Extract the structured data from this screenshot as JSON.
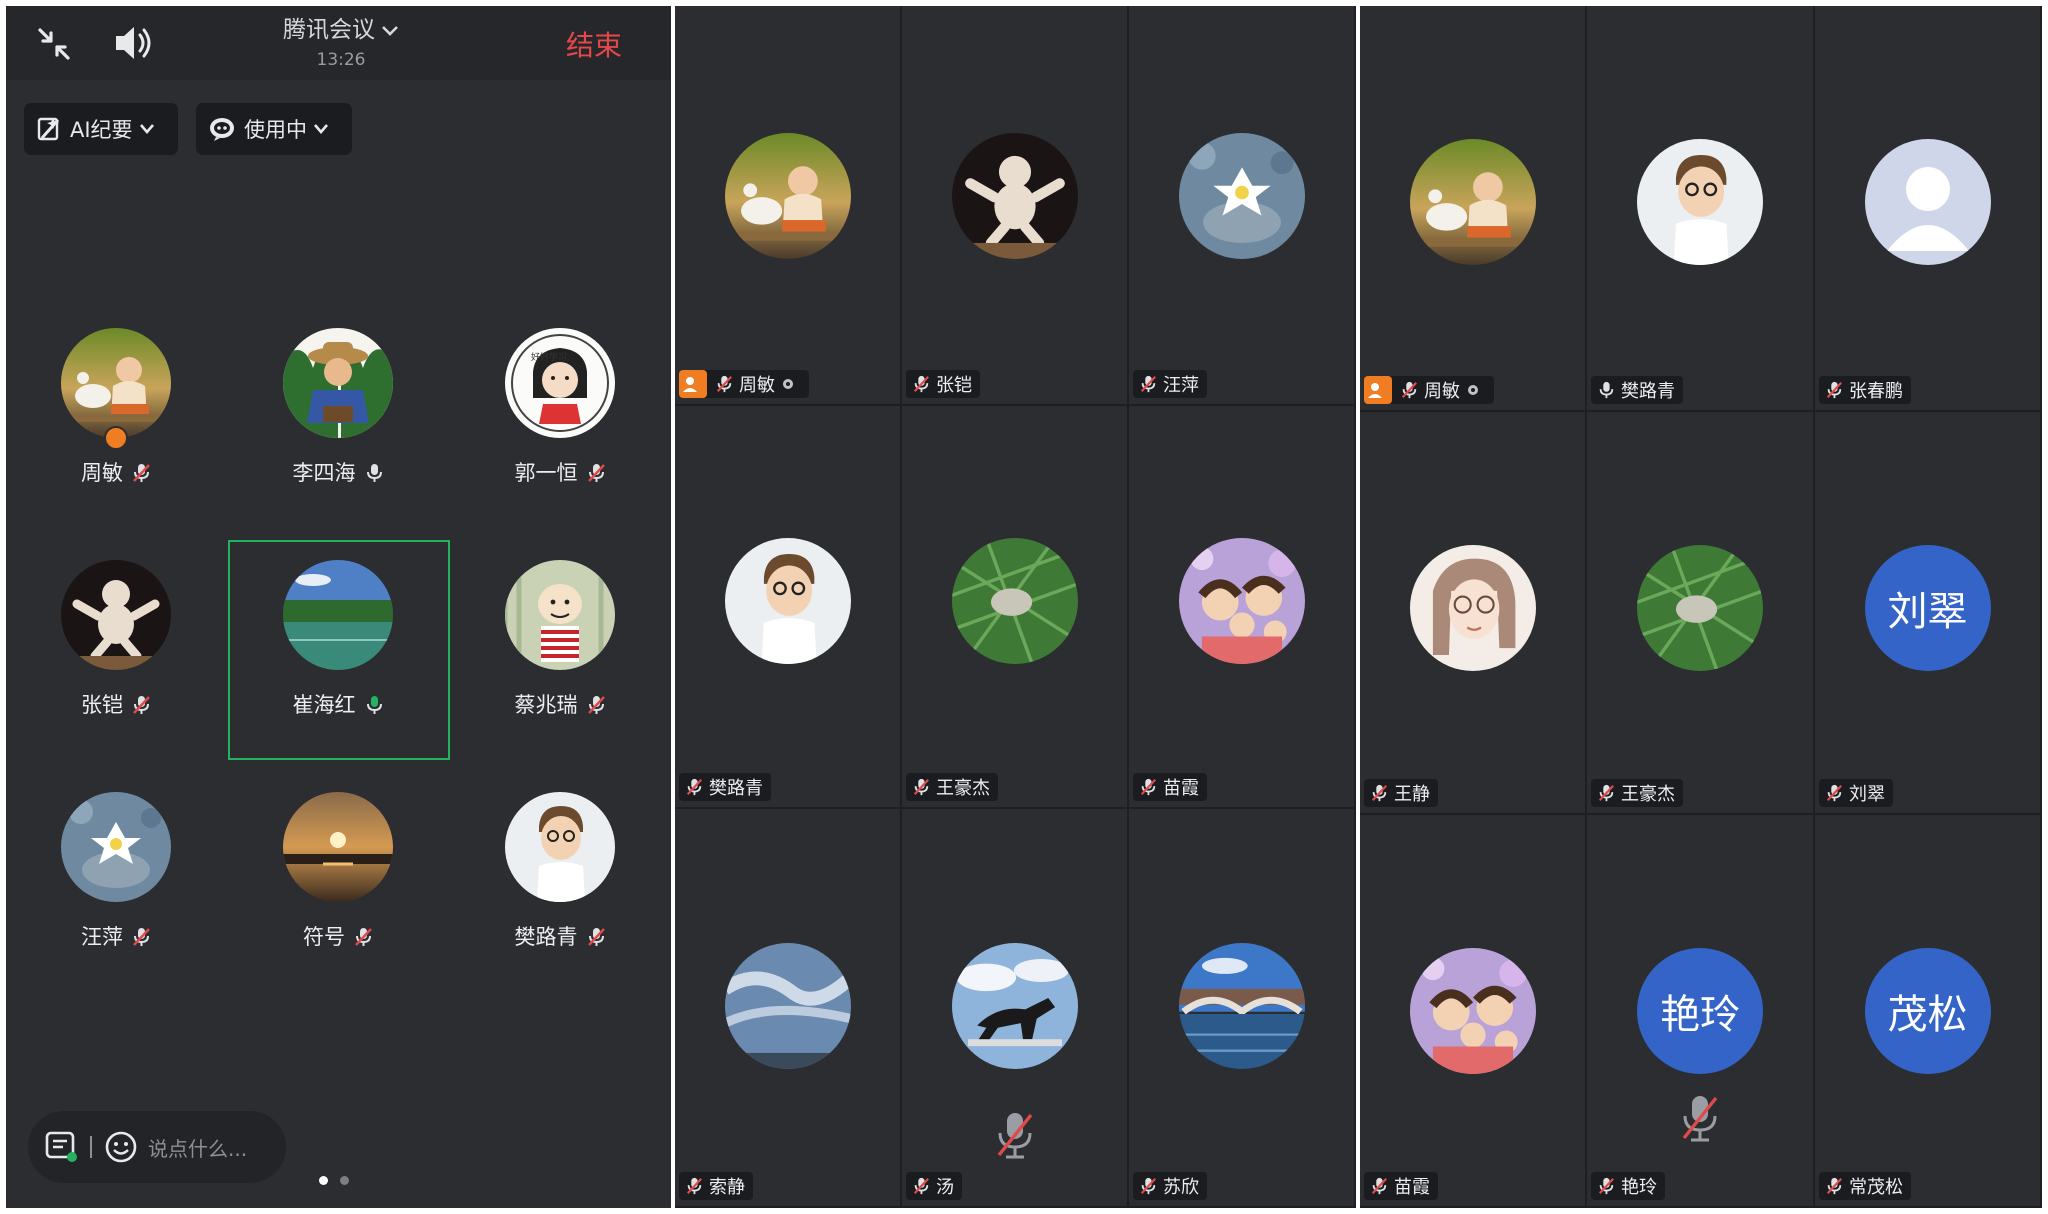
{
  "header": {
    "title": "腾讯会议",
    "time": "13:26",
    "end_label": "结束"
  },
  "toolbar": {
    "ai_label": "AI纪要",
    "inuse_label": "使用中"
  },
  "page1": {
    "participants": [
      {
        "name": "周敏",
        "mic": "muted",
        "host": true
      },
      {
        "name": "李四海",
        "mic": "on"
      },
      {
        "name": "郭一恒",
        "mic": "muted"
      },
      {
        "name": "张铠",
        "mic": "muted"
      },
      {
        "name": "崔海红",
        "mic": "speaking"
      },
      {
        "name": "蔡兆瑞",
        "mic": "muted"
      },
      {
        "name": "汪萍",
        "mic": "muted"
      },
      {
        "name": "符号",
        "mic": "muted"
      },
      {
        "name": "樊路青",
        "mic": "muted"
      }
    ],
    "chat_placeholder": "说点什么...",
    "page_indicator": {
      "total": 2,
      "current": 1
    }
  },
  "grid2": [
    {
      "name": "周敏",
      "host": true,
      "mic": "muted",
      "avatar": "girl-goose"
    },
    {
      "name": "张铠",
      "mic": "muted",
      "avatar": "figurine"
    },
    {
      "name": "汪萍",
      "mic": "muted",
      "avatar": "stone-flower"
    },
    {
      "name": "樊路青",
      "mic": "muted",
      "avatar": "cartoon-boy"
    },
    {
      "name": "王豪杰",
      "mic": "muted",
      "avatar": "grass"
    },
    {
      "name": "苗霞",
      "mic": "muted",
      "avatar": "family"
    },
    {
      "name": "索静",
      "mic": "muted",
      "avatar": "sky"
    },
    {
      "name": "汤",
      "mic": "muted",
      "avatar": "horse",
      "big_mute": true
    },
    {
      "name": "苏欣",
      "mic": "muted",
      "avatar": "bridge"
    }
  ],
  "grid3": [
    {
      "name": "周敏",
      "host": true,
      "mic": "muted",
      "avatar": "girl-goose"
    },
    {
      "name": "樊路青",
      "mic": "on",
      "avatar": "cartoon-boy"
    },
    {
      "name": "张春鹏",
      "mic": "muted",
      "avatar": "default"
    },
    {
      "name": "王静",
      "mic": "muted",
      "avatar": "sketch-girl"
    },
    {
      "name": "王豪杰",
      "mic": "muted",
      "avatar": "grass"
    },
    {
      "name": "刘翠",
      "mic": "muted",
      "avatar": "letter",
      "initials": "刘翠"
    },
    {
      "name": "苗霞",
      "mic": "muted",
      "avatar": "family"
    },
    {
      "name": "艳玲",
      "mic": "muted",
      "avatar": "letter",
      "initials": "艳玲",
      "big_mute": true
    },
    {
      "name": "常茂松",
      "mic": "muted",
      "avatar": "letter",
      "initials": "茂松"
    }
  ],
  "colors": {
    "background": "#2b2d31",
    "end": "#e6474a",
    "host": "#f07d22",
    "speaking": "#23b35f",
    "letter_avatar": "#3464c8",
    "muted_slash": "#e04a4a"
  }
}
